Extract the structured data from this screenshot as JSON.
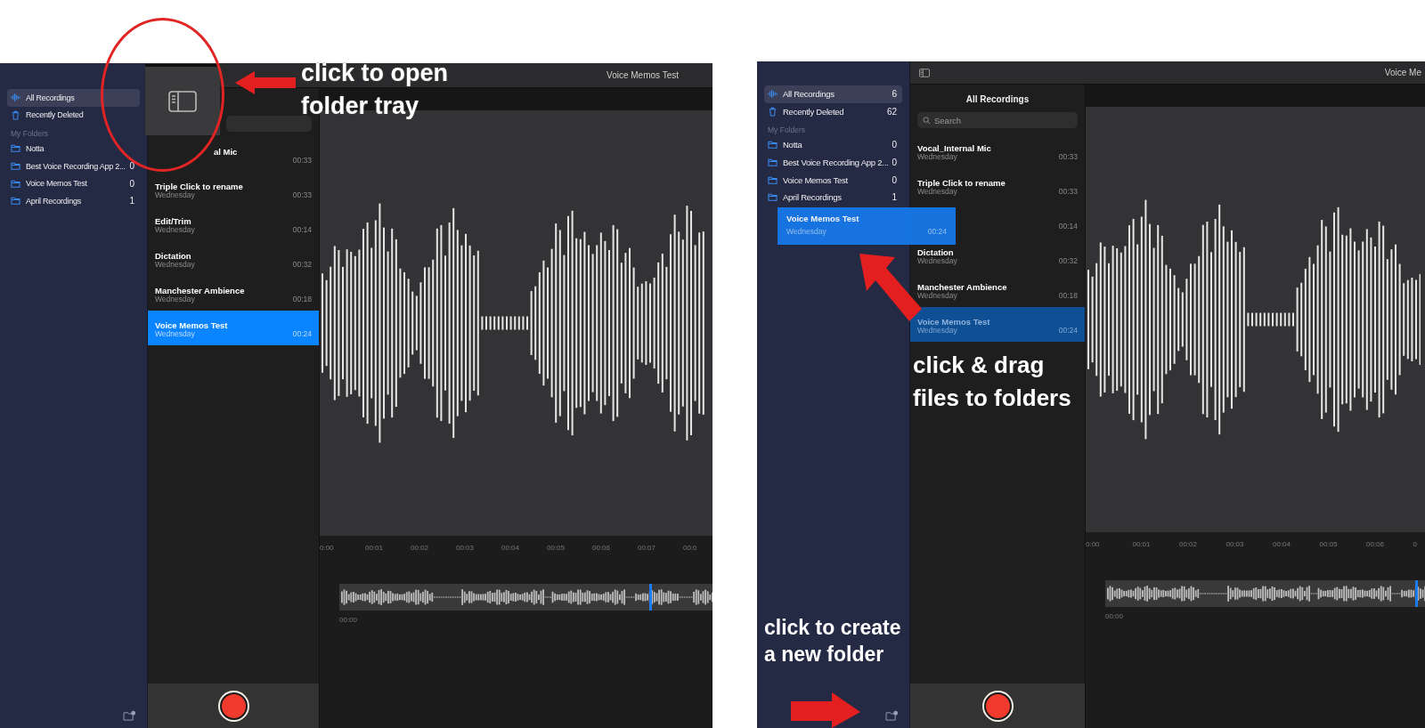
{
  "screens": [
    {
      "title_bar": {
        "title": "Voice Memos Test"
      },
      "sidebar": {
        "items": [
          {
            "label": "All Recordings",
            "kind": "all",
            "selected": true
          },
          {
            "label": "Recently Deleted",
            "kind": "trash",
            "selected": false
          }
        ],
        "section_header": "My Folders",
        "folders": [
          {
            "label": "Notta"
          },
          {
            "label": "Best Voice Recording App 2...",
            "count": "0"
          },
          {
            "label": "Voice Memos Test",
            "count": "0"
          },
          {
            "label": "April Recordings",
            "count": "1"
          }
        ]
      },
      "list": {
        "items": [
          {
            "kind": "clipped",
            "title": "al Mic",
            "duration": "00:33",
            "selected": false,
            "dragging": false
          },
          {
            "kind": "recording",
            "title": "Triple Click to rename",
            "date": "Wednesday",
            "duration": "00:33",
            "selected": false,
            "dragging": false
          },
          {
            "kind": "recording",
            "title": "Edit/Trim",
            "date": "Wednesday",
            "duration": "00:14",
            "selected": false,
            "dragging": false
          },
          {
            "kind": "recording",
            "title": "Dictation",
            "date": "Wednesday",
            "duration": "00:32",
            "selected": false,
            "dragging": false
          },
          {
            "kind": "recording",
            "title": "Manchester Ambience",
            "date": "Wednesday",
            "duration": "00:18",
            "selected": false,
            "dragging": false
          },
          {
            "kind": "recording",
            "title": "Voice Memos Test",
            "date": "Wednesday",
            "duration": "00:24",
            "selected": true,
            "dragging": false
          }
        ]
      },
      "timeline": {
        "ticks": [
          "0:00",
          "00:01",
          "00:02",
          "00:03",
          "00:04",
          "00:05",
          "00:06",
          "00:07",
          "00:0"
        ]
      },
      "scrubber": {
        "start_label": "00:00",
        "level": 0.83
      },
      "annotations": [
        {
          "text": "click to open\nfolder tray"
        }
      ]
    },
    {
      "title_bar": {
        "title": "Voice Me"
      },
      "sidebar": {
        "items": [
          {
            "label": "All Recordings",
            "kind": "all",
            "selected": true,
            "count": "6"
          },
          {
            "label": "Recently Deleted",
            "kind": "trash",
            "selected": false,
            "count": "62"
          }
        ],
        "section_header": "My Folders",
        "folders": [
          {
            "label": "Notta",
            "count": "0"
          },
          {
            "label": "Best Voice Recording App 2...",
            "count": "0"
          },
          {
            "label": "Voice Memos Test",
            "count": "0"
          },
          {
            "label": "April Recordings",
            "count": "1"
          }
        ]
      },
      "list": {
        "header": "All Recordings",
        "search_placeholder": "Search",
        "items": [
          {
            "kind": "recording",
            "title": "Vocal_Internal Mic",
            "date": "Wednesday",
            "duration": "00:33",
            "selected": false,
            "dragging": false
          },
          {
            "kind": "recording",
            "title": "Triple Click to rename",
            "date": "Wednesday",
            "duration": "00:33",
            "selected": false,
            "dragging": false
          },
          {
            "kind": "covered",
            "duration": "00:14",
            "selected": false,
            "dragging": false
          },
          {
            "kind": "recording",
            "title": "Dictation",
            "date": "Wednesday",
            "duration": "00:32",
            "selected": false,
            "dragging": false
          },
          {
            "kind": "recording",
            "title": "Manchester Ambience",
            "date": "Wednesday",
            "duration": "00:18",
            "selected": false,
            "dragging": false
          },
          {
            "kind": "recording",
            "title": "Voice Memos Test",
            "date": "Wednesday",
            "duration": "00:24",
            "selected": true,
            "dragging": true
          }
        ]
      },
      "drag_preview": {
        "title": "Voice Memos Test",
        "date": "Wednesday",
        "duration": "00:24"
      },
      "timeline": {
        "ticks": [
          "0:00",
          "00:01",
          "00:02",
          "00:03",
          "00:04",
          "00:05",
          "00:06",
          "0"
        ]
      },
      "scrubber": {
        "start_label": "00:00",
        "level": 0.97
      },
      "annotations": [
        {
          "text": "click & drag\nfiles to folders"
        },
        {
          "text": "click to create\na new folder"
        }
      ]
    }
  ]
}
